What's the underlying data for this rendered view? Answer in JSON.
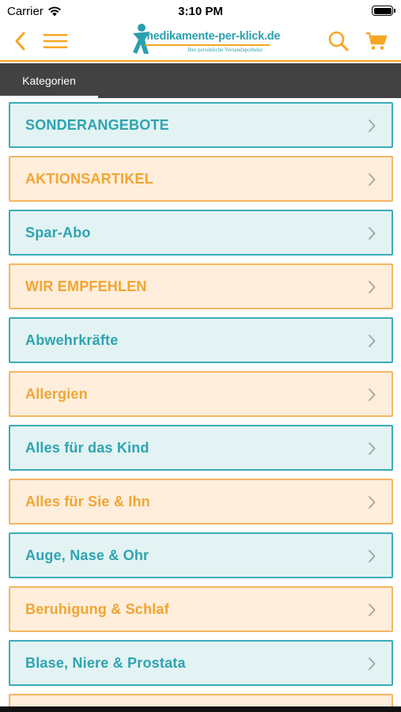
{
  "status_bar": {
    "carrier": "Carrier",
    "time": "3:10 PM"
  },
  "header": {
    "logo_text": "medikamente-per-klick.de",
    "logo_tagline": "Ihre persönliche Versandapotheke",
    "accent_color": "#f5a623",
    "brand_color": "#2a9fb0"
  },
  "tabs": [
    {
      "label": "Kategorien",
      "active": true
    }
  ],
  "categories": [
    {
      "label": "SONDERANGEBOTE",
      "style": "blue"
    },
    {
      "label": "AKTIONSARTIKEL",
      "style": "orange"
    },
    {
      "label": "Spar-Abo",
      "style": "blue"
    },
    {
      "label": "WIR EMPFEHLEN",
      "style": "orange"
    },
    {
      "label": "Abwehrkräfte",
      "style": "blue"
    },
    {
      "label": "Allergien",
      "style": "orange"
    },
    {
      "label": "Alles für das Kind",
      "style": "blue"
    },
    {
      "label": "Alles für Sie & Ihn",
      "style": "orange"
    },
    {
      "label": "Auge, Nase & Ohr",
      "style": "blue"
    },
    {
      "label": "Beruhigung & Schlaf",
      "style": "orange"
    },
    {
      "label": "Blase, Niere & Prostata",
      "style": "blue"
    },
    {
      "label": "",
      "style": "orange"
    }
  ],
  "icons": {
    "back": "chevron-left-icon",
    "menu": "hamburger-menu-icon",
    "search": "search-icon",
    "cart": "shopping-cart-icon",
    "category_arrow": "chevron-right-icon"
  }
}
